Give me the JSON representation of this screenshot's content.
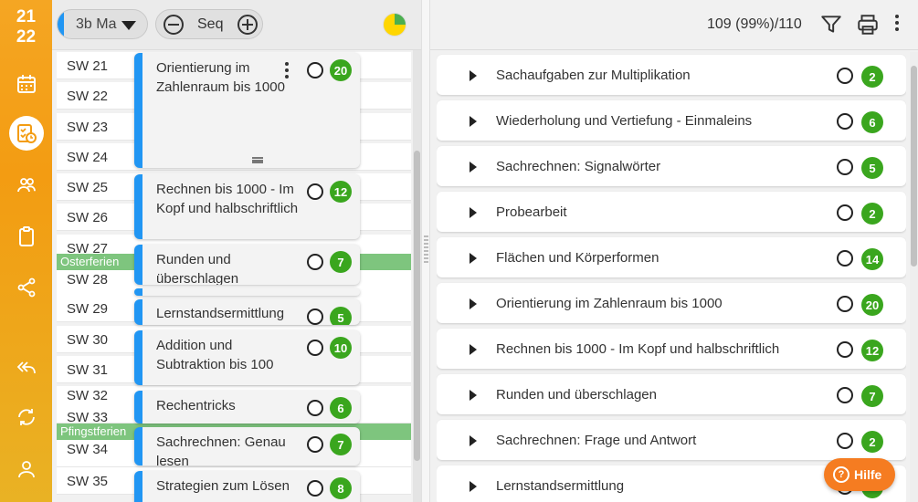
{
  "sidebar": {
    "year_top": "21",
    "year_bottom": "22",
    "items": [
      {
        "icon": "calendar-icon"
      },
      {
        "icon": "checklist-clock-icon",
        "active": true
      },
      {
        "icon": "people-icon"
      },
      {
        "icon": "clipboard-icon"
      },
      {
        "icon": "share-icon"
      },
      {
        "icon": "reply-all-icon"
      },
      {
        "icon": "sync-icon"
      },
      {
        "icon": "user-icon"
      }
    ]
  },
  "left_toolbar": {
    "class_select": "3b Ma",
    "seq_label": "Seq",
    "progress_pie": {
      "green_fraction": 0.25,
      "yellow_fraction": 0.75
    }
  },
  "weeks": [
    "SW 21",
    "SW 22",
    "SW 23",
    "SW 24",
    "SW 25",
    "SW 26",
    "SW 27",
    "SW 28",
    "SW 29",
    "SW 30",
    "SW 31",
    "SW 32",
    "SW 33",
    "SW 34",
    "SW 35"
  ],
  "holidays": [
    "Osterferien",
    "Pfingstferien"
  ],
  "cards": [
    {
      "title": "Orientierung im Zahlenraum bis 1000",
      "count": "20"
    },
    {
      "title": "Rechnen bis 1000 - Im Kopf und halbschriftlich",
      "count": "12"
    },
    {
      "title": "Runden und überschlagen",
      "count": "7"
    },
    {
      "title": "Lernstandsermittlung",
      "count": "5"
    },
    {
      "title": "Addition und Subtraktion bis 100",
      "count": "10"
    },
    {
      "title": "Rechentricks",
      "count": "6"
    },
    {
      "title": "Sachrechnen: Genau lesen",
      "count": "7"
    },
    {
      "title": "Strategien zum Lösen",
      "count": "8"
    }
  ],
  "right_toolbar": {
    "count_text": "109 (99%)/110"
  },
  "topics": [
    {
      "label": "Sachaufgaben zur Multiplikation",
      "count": "2"
    },
    {
      "label": "Wiederholung und Vertiefung - Einmaleins",
      "count": "6"
    },
    {
      "label": "Sachrechnen: Signalwörter",
      "count": "5"
    },
    {
      "label": "Probearbeit",
      "count": "2"
    },
    {
      "label": "Flächen und Körperformen",
      "count": "14"
    },
    {
      "label": "Orientierung im Zahlenraum bis 1000",
      "count": "20"
    },
    {
      "label": "Rechnen bis 1000 - Im Kopf und halbschriftlich",
      "count": "12"
    },
    {
      "label": "Runden und überschlagen",
      "count": "7"
    },
    {
      "label": "Sachrechnen: Frage und Antwort",
      "count": "2"
    },
    {
      "label": "Lernstandsermittlung",
      "count": ""
    }
  ],
  "help_button": {
    "label": "Hilfe"
  },
  "colors": {
    "accent": "#2196f3",
    "badge": "#3aa61e",
    "sidebar": "#f5a623",
    "holiday": "#7ec57e",
    "help": "#f57c21"
  }
}
